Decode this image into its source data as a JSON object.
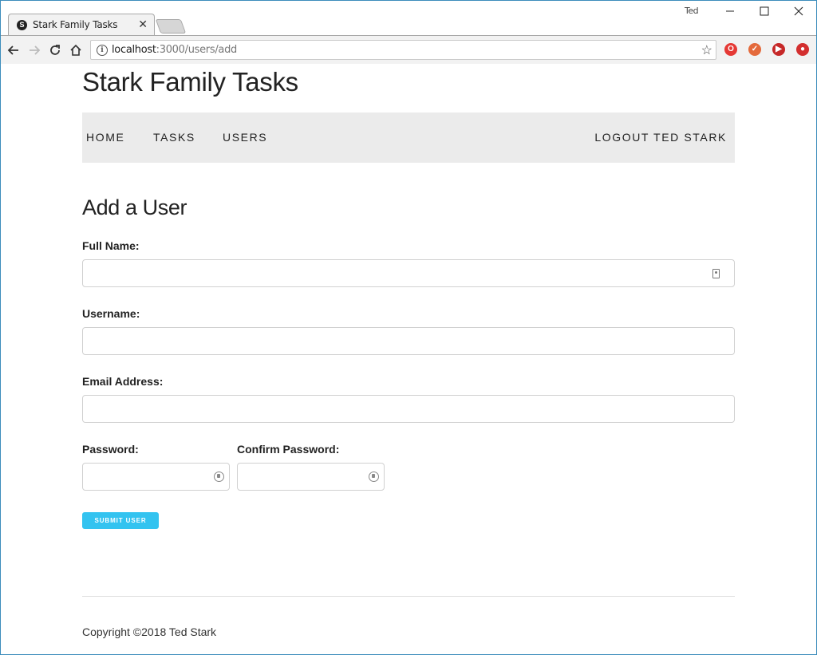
{
  "browser": {
    "tab_title": "Stark Family Tasks",
    "tab_favicon": "S",
    "tab_close": "✕",
    "profile_name": "Ted",
    "url_host": "localhost",
    "url_path": ":3000/users/add",
    "extensions": [
      "opera-icon",
      "ext-red-icon",
      "youtube-icon",
      "ext-red-circle-icon"
    ]
  },
  "site": {
    "title": "Stark Family Tasks"
  },
  "nav": {
    "home": "Home",
    "tasks": "Tasks",
    "users": "Users",
    "logout": "Logout Ted Stark"
  },
  "form": {
    "heading": "Add a User",
    "full_name_label": "Full Name:",
    "full_name_value": "",
    "username_label": "Username:",
    "username_value": "",
    "email_label": "Email Address:",
    "email_value": "",
    "password_label": "Password:",
    "password_value": "",
    "confirm_password_label": "Confirm Password:",
    "confirm_password_value": "",
    "submit_label": "Submit User"
  },
  "footer": {
    "copyright": "Copyright ©2018 Ted Stark"
  },
  "colors": {
    "accent": "#33c3f0",
    "navbar_bg": "#ebebeb"
  }
}
